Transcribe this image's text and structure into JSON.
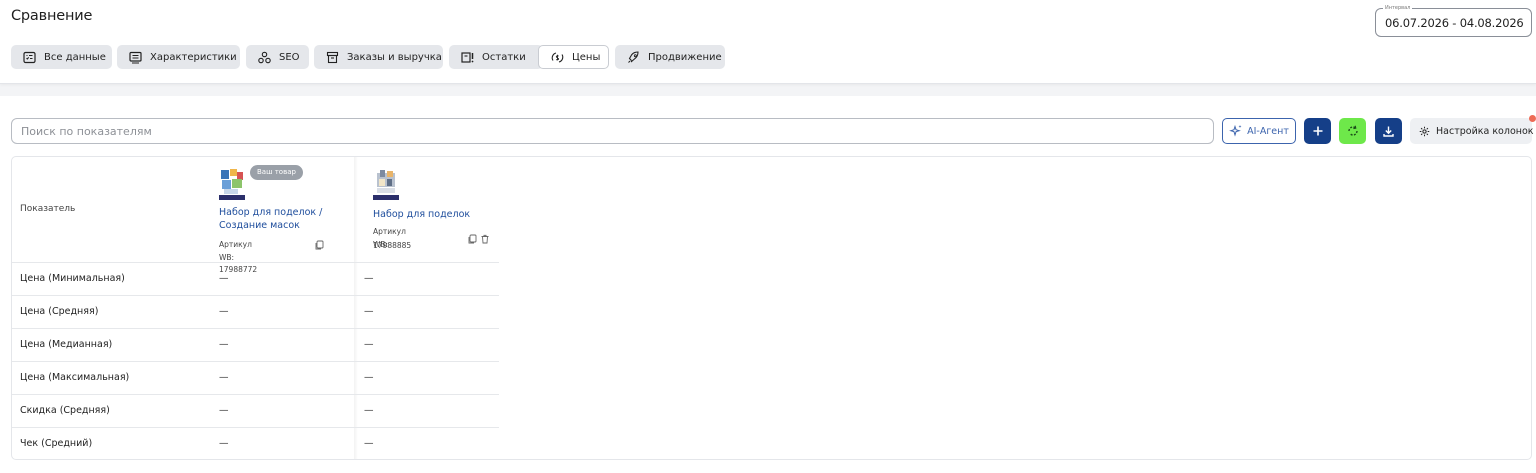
{
  "page": {
    "title": "Сравнение"
  },
  "interval": {
    "label": "Интервал",
    "value": "06.07.2026 - 04.08.2026"
  },
  "tabs": [
    {
      "label": "Все данные",
      "icon": "data-list-icon",
      "active": false
    },
    {
      "label": "Характеристики",
      "icon": "specs-icon",
      "active": false
    },
    {
      "label": "SEO",
      "icon": "seo-icon",
      "active": false
    },
    {
      "label": "Заказы и выручка",
      "icon": "orders-box-icon",
      "active": false
    },
    {
      "label": "Остатки",
      "icon": "stock-icon",
      "active": false
    },
    {
      "label": "Цены",
      "icon": "price-icon",
      "active": true
    },
    {
      "label": "Продвижение",
      "icon": "rocket-icon",
      "active": false
    }
  ],
  "toolbar": {
    "search_placeholder": "Поиск по показателям",
    "ai_label": "AI-Агент",
    "columns_label": "Настройка колонок"
  },
  "colors": {
    "accent_dark": "#153f88",
    "refresh_green": "#6ee84a",
    "link_blue": "#1e4d9c",
    "badge_gray": "#9aa0a8",
    "notif_red": "#ee6a55"
  },
  "table": {
    "header_label": "Показатель",
    "products": [
      {
        "badge": "Ваш товар",
        "name": "Набор для поделок / Создание масок",
        "sku_line1": "Артикул WB: 17988772",
        "sku_line2": ""
      },
      {
        "badge": "",
        "name": "Набор для поделок",
        "sku_line1": "Артикул WB:",
        "sku_line2": "17988885"
      }
    ],
    "rows": [
      {
        "label": "Цена (Минимальная)",
        "v1": "—",
        "v2": "—"
      },
      {
        "label": "Цена (Средняя)",
        "v1": "—",
        "v2": "—"
      },
      {
        "label": "Цена (Медианная)",
        "v1": "—",
        "v2": "—"
      },
      {
        "label": "Цена (Максимальная)",
        "v1": "—",
        "v2": "—"
      },
      {
        "label": "Скидка (Средняя)",
        "v1": "—",
        "v2": "—"
      },
      {
        "label": "Чек (Средний)",
        "v1": "—",
        "v2": "—"
      }
    ]
  }
}
